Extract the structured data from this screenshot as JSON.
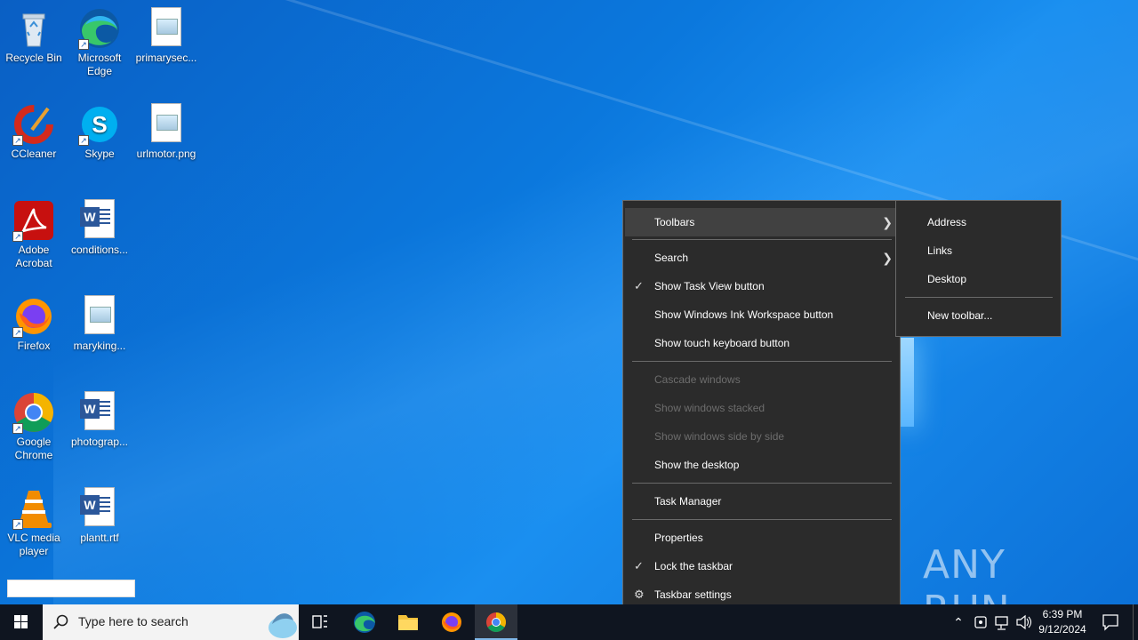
{
  "desktop": {
    "icons": [
      {
        "label": "Recycle Bin",
        "icon": "recycle-bin-icon"
      },
      {
        "label": "Microsoft Edge",
        "icon": "edge-icon"
      },
      {
        "label": "primarysec...",
        "icon": "image-file-icon"
      },
      {
        "label": "CCleaner",
        "icon": "ccleaner-icon"
      },
      {
        "label": "Skype",
        "icon": "skype-icon"
      },
      {
        "label": "urlmotor.png",
        "icon": "image-file-icon"
      },
      {
        "label": "Adobe Acrobat",
        "icon": "acrobat-icon"
      },
      {
        "label": "conditions...",
        "icon": "word-doc-icon"
      },
      {
        "label": "Firefox",
        "icon": "firefox-icon"
      },
      {
        "label": "maryking...",
        "icon": "image-file-icon"
      },
      {
        "label": "Google Chrome",
        "icon": "chrome-icon"
      },
      {
        "label": "photograp...",
        "icon": "word-doc-icon"
      },
      {
        "label": "VLC media player",
        "icon": "vlc-icon"
      },
      {
        "label": "plantt.rtf",
        "icon": "word-doc-icon"
      }
    ]
  },
  "context_menu": {
    "items": [
      {
        "label": "Toolbars",
        "state": "highlighted",
        "submenu": true
      },
      {
        "label": "Search",
        "submenu": true
      },
      {
        "label": "Show Task View button",
        "checked": true
      },
      {
        "label": "Show Windows Ink Workspace button"
      },
      {
        "label": "Show touch keyboard button"
      },
      {
        "label": "Cascade windows",
        "disabled": true
      },
      {
        "label": "Show windows stacked",
        "disabled": true
      },
      {
        "label": "Show windows side by side",
        "disabled": true
      },
      {
        "label": "Show the desktop"
      },
      {
        "label": "Task Manager"
      },
      {
        "label": "Properties"
      },
      {
        "label": "Lock the taskbar",
        "checked": true
      },
      {
        "label": "Taskbar settings",
        "icon": "gear-icon"
      }
    ]
  },
  "toolbars_submenu": {
    "items": [
      "Address",
      "Links",
      "Desktop",
      "New toolbar..."
    ]
  },
  "watermark": "ANY RUN",
  "taskbar": {
    "search_placeholder": "Type here to search",
    "apps": [
      "task-view",
      "edge",
      "file-explorer",
      "firefox",
      "chrome"
    ],
    "active_app": "chrome",
    "clock_time": "6:39 PM",
    "clock_date": "9/12/2024"
  },
  "colors": {
    "menu_bg": "#2b2b2b",
    "menu_highlight": "#414141",
    "taskbar_bg": "#0f1520",
    "desktop_blue": "#0b78dd"
  }
}
